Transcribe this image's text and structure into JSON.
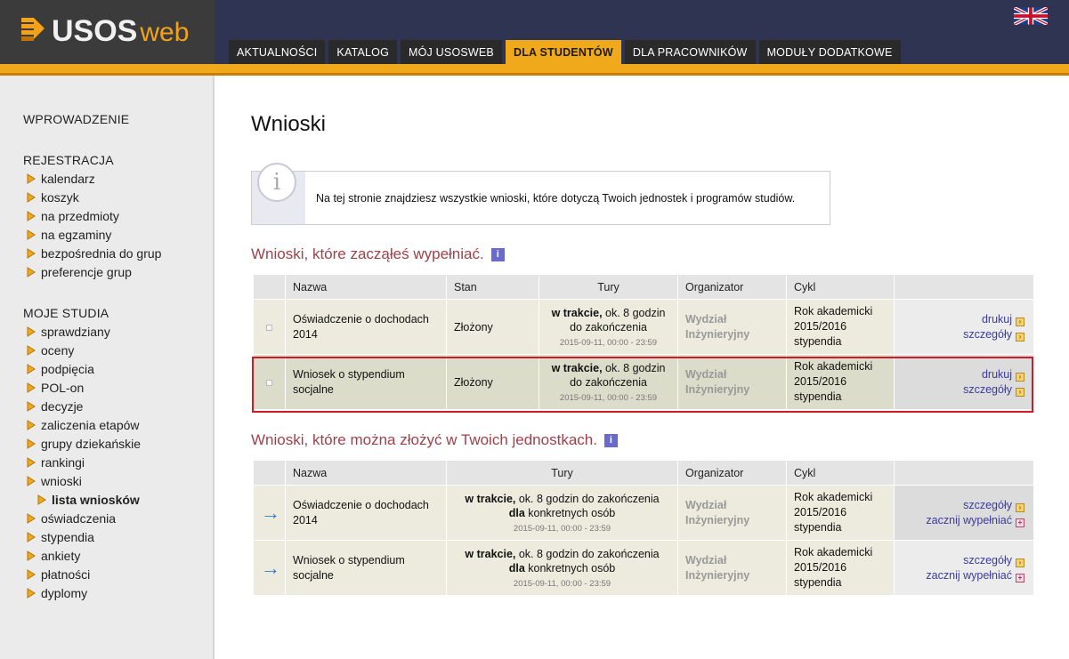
{
  "header": {
    "logo_main": "USOS",
    "logo_web": "web",
    "nav": [
      {
        "label": "AKTUALNOŚCI"
      },
      {
        "label": "KATALOG"
      },
      {
        "label": "MÓJ USOSWEB"
      },
      {
        "label": "DLA STUDENTÓW"
      },
      {
        "label": "DLA PRACOWNIKÓW"
      },
      {
        "label": "MODUŁY DODATKOWE"
      }
    ],
    "active_tab": "DLA STUDENTÓW",
    "language_icon": "uk-flag-icon"
  },
  "sidebar": {
    "intro": "WPROWADZENIE",
    "rejestracja": {
      "heading": "REJESTRACJA",
      "items": [
        "kalendarz",
        "koszyk",
        "na przedmioty",
        "na egzaminy",
        "bezpośrednia do grup",
        "preferencje grup"
      ]
    },
    "moje_studia": {
      "heading": "MOJE STUDIA",
      "items": [
        "sprawdziany",
        "oceny",
        "podpięcia",
        "POL-on",
        "decyzje",
        "zaliczenia etapów",
        "grupy dziekańskie",
        "rankingi",
        "wnioski"
      ],
      "active_sub": "lista wniosków",
      "items_after": [
        "oświadczenia",
        "stypendia",
        "ankiety",
        "płatności",
        "dyplomy"
      ]
    }
  },
  "main": {
    "title": "Wnioski",
    "info_text": "Na tej stronie znajdziesz wszystkie wnioski, które dotyczą Twoich jednostek i programów studiów.",
    "section1": {
      "title": "Wnioski, które zacząłeś wypełniać.",
      "headers": {
        "name": "Nazwa",
        "state": "Stan",
        "tury": "Tury",
        "org": "Organizator",
        "cycle": "Cykl"
      },
      "rows": [
        {
          "name_1": "Oświadczenie o dochodach",
          "name_2": "2014",
          "state": "Złożony",
          "tury_bold": "w trakcie,",
          "tury_rest": " ok. 8 godzin",
          "tury_line2": "do zakończenia",
          "tury_date": "2015-09-11, 00:00 - 23:59",
          "org_1": "Wydział",
          "org_2": "Inżynieryjny",
          "cycle_1": "Rok akademicki",
          "cycle_2": "2015/2016",
          "cycle_3": "stypendia",
          "action_1": "drukuj",
          "action_2": "szczegóły"
        },
        {
          "name_1": "Wniosek o stypendium",
          "name_2": "socjalne",
          "state": "Złożony",
          "tury_bold": "w trakcie,",
          "tury_rest": " ok. 8 godzin",
          "tury_line2": "do zakończenia",
          "tury_date": "2015-09-11, 00:00 - 23:59",
          "org_1": "Wydział",
          "org_2": "Inżynieryjny",
          "cycle_1": "Rok akademicki",
          "cycle_2": "2015/2016",
          "cycle_3": "stypendia",
          "action_1": "drukuj",
          "action_2": "szczegóły"
        }
      ]
    },
    "section2": {
      "title": "Wnioski, które można złożyć w Twoich jednostkach.",
      "headers": {
        "name": "Nazwa",
        "tury": "Tury",
        "org": "Organizator",
        "cycle": "Cykl"
      },
      "rows": [
        {
          "name_1": "Oświadczenie o dochodach",
          "name_2": "2014",
          "tury_bold": "w trakcie,",
          "tury_rest": " ok. 8 godzin do zakończenia",
          "tury_bold2": "dla",
          "tury_rest2": " konkretnych osób",
          "tury_date": "2015-09-11, 00:00 - 23:59",
          "org_1": "Wydział",
          "org_2": "Inżynieryjny",
          "cycle_1": "Rok akademicki",
          "cycle_2": "2015/2016",
          "cycle_3": "stypendia",
          "action_1": "szczegóły",
          "action_2": "zacznij wypełniać"
        },
        {
          "name_1": "Wniosek o stypendium",
          "name_2": "socjalne",
          "tury_bold": "w trakcie,",
          "tury_rest": " ok. 8 godzin do zakończenia",
          "tury_bold2": "dla",
          "tury_rest2": " konkretnych osób",
          "tury_date": "2015-09-11, 00:00 - 23:59",
          "org_1": "Wydział",
          "org_2": "Inżynieryjny",
          "cycle_1": "Rok akademicki",
          "cycle_2": "2015/2016",
          "cycle_3": "stypendia",
          "action_1": "szczegóły",
          "action_2": "zacznij wypełniać"
        }
      ]
    }
  }
}
